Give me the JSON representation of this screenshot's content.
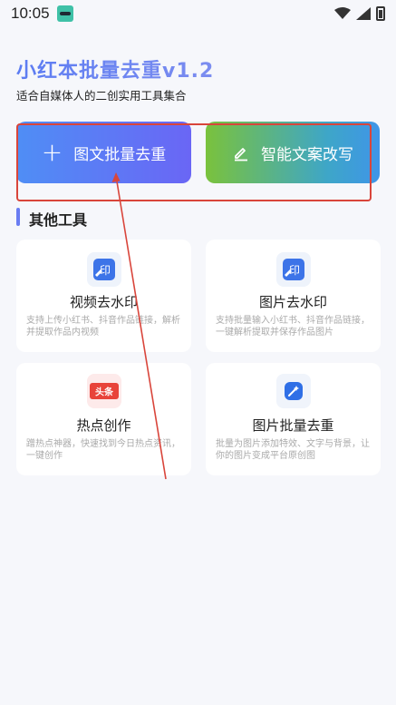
{
  "status_bar": {
    "time": "10:05",
    "icons": [
      "app-notification-icon",
      "wifi-icon",
      "signal-icon",
      "battery-icon"
    ]
  },
  "header": {
    "title": "小红本批量去重v1.2",
    "subtitle": "适合自媒体人的二创实用工具集合"
  },
  "actions": {
    "batch_label": "图文批量去重",
    "rewrite_label": "智能文案改写"
  },
  "section": {
    "title": "其他工具"
  },
  "tools": [
    {
      "name": "视频去水印",
      "desc": "支持上传小红书、抖音作品链接，解析并提取作品内视频",
      "icon": "watermark-icon",
      "icon_text": "印"
    },
    {
      "name": "图片去水印",
      "desc": "支持批量输入小红书、抖音作品链接，一键解析提取并保存作品图片",
      "icon": "watermark-icon",
      "icon_text": "印"
    },
    {
      "name": "热点创作",
      "desc": "蹭热点神器，快速找到今日热点资讯，一键创作",
      "icon": "toutiao-icon",
      "icon_text": "头条"
    },
    {
      "name": "图片批量去重",
      "desc": "批量为图片添加特效、文字与背景，让你的图片变成平台原创图",
      "icon": "magic-tool-icon",
      "icon_text": ""
    }
  ],
  "colors": {
    "accent": "#6a7df2",
    "batch_gradient": [
      "#4f8ef5",
      "#6a66f5"
    ],
    "rewrite_gradient": [
      "#7ac23c",
      "#3f95e8"
    ],
    "annotation": "#d9453b",
    "background": "#f6f7fb"
  }
}
